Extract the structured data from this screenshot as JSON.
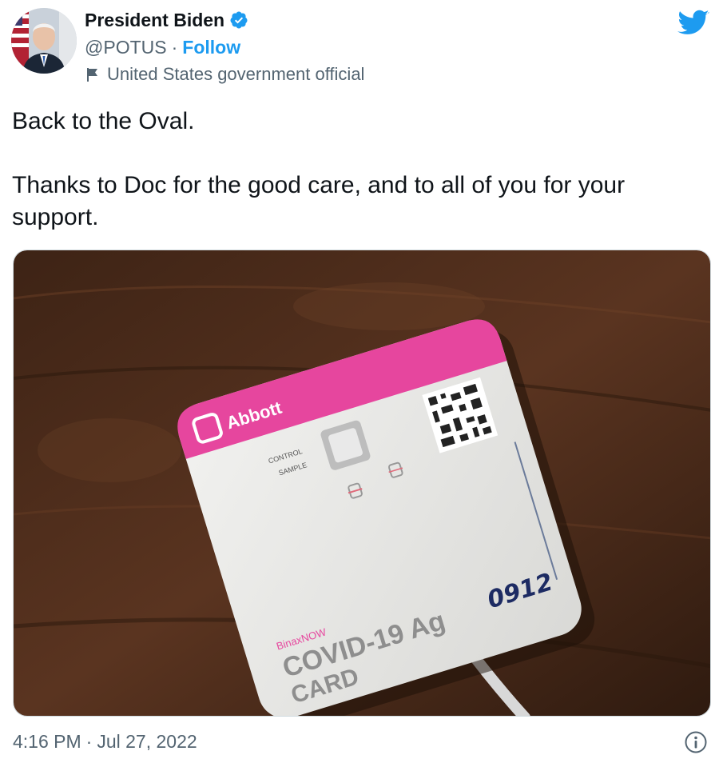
{
  "author": {
    "display_name": "President Biden",
    "handle": "@POTUS",
    "separator": "·",
    "follow_label": "Follow",
    "account_label": "United States government official"
  },
  "tweet": {
    "line1": "Back to the Oval.",
    "line2": "Thanks to Doc for the good care, and to all of you for your support."
  },
  "media": {
    "card_brand": "Abbott",
    "card_control": "CONTROL",
    "card_sample": "SAMPLE",
    "card_product_small": "BinaxNOW",
    "card_product_line1": "COVID-19 Ag",
    "card_product_line2": "CARD",
    "card_handwritten": "0912"
  },
  "footer": {
    "time": "4:16 PM",
    "separator": "·",
    "date": "Jul 27, 2022"
  },
  "colors": {
    "accent": "#1d9bf0",
    "card_pink": "#e6469e",
    "table_wood": "#4a2a18"
  },
  "icons": {
    "verified": "verified-badge-icon",
    "flag": "flag-icon",
    "bird": "twitter-bird-icon",
    "info": "info-icon"
  }
}
